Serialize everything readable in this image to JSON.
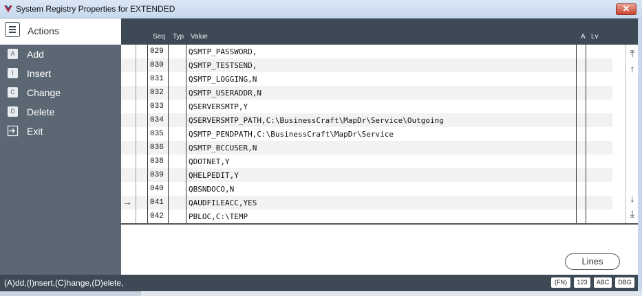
{
  "window": {
    "title": "System Registry Properties  for EXTENDED",
    "close_glyph": "✕"
  },
  "sidebar": {
    "header_label": "Actions",
    "items": [
      {
        "key": "A",
        "label": "Add"
      },
      {
        "key": "I",
        "label": "Insert"
      },
      {
        "key": "C",
        "label": "Change"
      },
      {
        "key": "D",
        "label": "Delete"
      },
      {
        "key": "exit-icon",
        "label": "Exit"
      }
    ]
  },
  "grid": {
    "columns": {
      "seq": "Seq",
      "typ": "Typ",
      "value": "Value",
      "a": "A",
      "lv": "Lv"
    },
    "rows": [
      {
        "seq": "029",
        "typ": "",
        "value": "QSMTP_PASSWORD,"
      },
      {
        "seq": "030",
        "typ": "",
        "value": "QSMTP_TESTSEND,"
      },
      {
        "seq": "031",
        "typ": "",
        "value": "QSMTP_LOGGING,N"
      },
      {
        "seq": "032",
        "typ": "",
        "value": "QSMTP_USERADDR,N"
      },
      {
        "seq": "033",
        "typ": "",
        "value": "QSERVERSMTP,Y"
      },
      {
        "seq": "034",
        "typ": "",
        "value": "QSERVERSMTP_PATH,C:\\BusinessCraft\\MapDr\\Service\\Outgoing"
      },
      {
        "seq": "035",
        "typ": "",
        "value": "QSMTP_PENDPATH,C:\\BusinessCraft\\MapDr\\Service"
      },
      {
        "seq": "036",
        "typ": "",
        "value": "QSMTP_BCCUSER,N"
      },
      {
        "seq": "038",
        "typ": "",
        "value": "QDOTNET,Y"
      },
      {
        "seq": "039",
        "typ": "",
        "value": "QHELPEDIT,Y"
      },
      {
        "seq": "040",
        "typ": "",
        "value": "QBSNDOCO,N"
      },
      {
        "seq": "041",
        "typ": "",
        "value": "QAUDFILEACC,YES"
      },
      {
        "seq": "042",
        "typ": "",
        "value": "PBLOC,C:\\TEMP"
      }
    ],
    "current_row_marker": "→",
    "scroll": {
      "top": "⤒",
      "up": "↑",
      "down": "↓",
      "bottom": "⤓"
    }
  },
  "buttons": {
    "lines": "Lines"
  },
  "status_bar": {
    "text": "(A)dd,(I)nsert,(C)hange,(D)elete,",
    "indicators": [
      "(FN)",
      "123",
      "ABC",
      "DBG"
    ]
  }
}
